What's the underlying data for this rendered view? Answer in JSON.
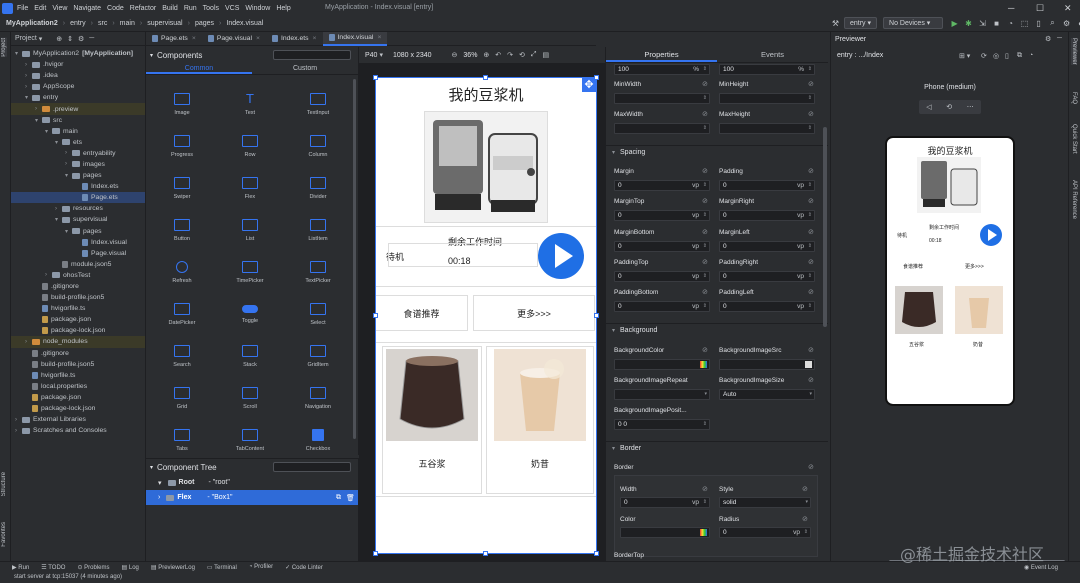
{
  "menu": [
    "File",
    "Edit",
    "View",
    "Navigate",
    "Code",
    "Refactor",
    "Build",
    "Run",
    "Tools",
    "VCS",
    "Window",
    "Help"
  ],
  "window_title": "MyApplication - Index.visual [entry]",
  "breadcrumbs": [
    "MyApplication2",
    "entry",
    "src",
    "main",
    "supervisual",
    "pages",
    "Index.visual"
  ],
  "run": {
    "config": "entry",
    "devices": "No Devices"
  },
  "project": {
    "title": "Project",
    "items": [
      {
        "label": "MyApplication2",
        "bold": "[MyApplication]",
        "indent": 0,
        "type": "folder"
      },
      {
        "label": ".hvigor",
        "indent": 1,
        "type": "folder"
      },
      {
        "label": ".idea",
        "indent": 1,
        "type": "folder"
      },
      {
        "label": "AppScope",
        "indent": 1,
        "type": "folder"
      },
      {
        "label": "entry",
        "indent": 1,
        "type": "folder"
      },
      {
        "label": ".preview",
        "indent": 2,
        "type": "folder-o"
      },
      {
        "label": "src",
        "indent": 2,
        "type": "folder"
      },
      {
        "label": "main",
        "indent": 3,
        "type": "folder"
      },
      {
        "label": "ets",
        "indent": 4,
        "type": "folder"
      },
      {
        "label": "entryability",
        "indent": 5,
        "type": "folder"
      },
      {
        "label": "images",
        "indent": 5,
        "type": "folder"
      },
      {
        "label": "pages",
        "indent": 5,
        "type": "folder"
      },
      {
        "label": "Index.ets",
        "indent": 6,
        "type": "file"
      },
      {
        "label": "Page.ets",
        "indent": 6,
        "type": "file"
      },
      {
        "label": "resources",
        "indent": 4,
        "type": "folder"
      },
      {
        "label": "supervisual",
        "indent": 4,
        "type": "folder"
      },
      {
        "label": "pages",
        "indent": 5,
        "type": "folder"
      },
      {
        "label": "Index.visual",
        "indent": 6,
        "type": "file"
      },
      {
        "label": "Page.visual",
        "indent": 6,
        "type": "file"
      },
      {
        "label": "module.json5",
        "indent": 4,
        "type": "file-g"
      },
      {
        "label": "ohosTest",
        "indent": 3,
        "type": "folder"
      },
      {
        "label": ".gitignore",
        "indent": 2,
        "type": "file-g"
      },
      {
        "label": "build-profile.json5",
        "indent": 2,
        "type": "file-g"
      },
      {
        "label": "hvigorfile.ts",
        "indent": 2,
        "type": "file"
      },
      {
        "label": "package.json",
        "indent": 2,
        "type": "file-j"
      },
      {
        "label": "package-lock.json",
        "indent": 2,
        "type": "file-j"
      },
      {
        "label": "node_modules",
        "indent": 1,
        "type": "folder-o"
      },
      {
        "label": ".gitignore",
        "indent": 1,
        "type": "file-g"
      },
      {
        "label": "build-profile.json5",
        "indent": 1,
        "type": "file-g"
      },
      {
        "label": "hvigorfile.ts",
        "indent": 1,
        "type": "file"
      },
      {
        "label": "local.properties",
        "indent": 1,
        "type": "file-g"
      },
      {
        "label": "package.json",
        "indent": 1,
        "type": "file-j"
      },
      {
        "label": "package-lock.json",
        "indent": 1,
        "type": "file-j"
      },
      {
        "label": "External Libraries",
        "indent": 0,
        "type": "folder"
      },
      {
        "label": "Scratches and Consoles",
        "indent": 0,
        "type": "folder"
      }
    ]
  },
  "tabs": [
    "Page.ets",
    "Page.visual",
    "Index.ets",
    "Index.visual"
  ],
  "components": {
    "title": "Components",
    "tabs": [
      "Common",
      "Custom"
    ],
    "items": [
      "Image",
      "Text",
      "TextInput",
      "Progress",
      "Row",
      "Column",
      "Swiper",
      "Flex",
      "Divider",
      "Button",
      "List",
      "ListItem",
      "Refresh",
      "TimePicker",
      "TextPicker",
      "DatePicker",
      "Toggle",
      "Select",
      "Search",
      "Stack",
      "GridItem",
      "Grid",
      "Scroll",
      "Navigation",
      "Tabs",
      "TabContent",
      "Checkbox"
    ]
  },
  "component_tree": {
    "title": "Component Tree",
    "rows": [
      {
        "name": "Root",
        "id": "- \"root\""
      },
      {
        "name": "Flex",
        "id": "- \"Box1\""
      }
    ]
  },
  "canvas": {
    "device": "P40",
    "resolution": "1080 x 2340",
    "zoom": "36%"
  },
  "phone": {
    "title": "我的豆浆机",
    "status": "待机",
    "remaining_label": "剩余工作时间",
    "time": "00:18",
    "btn_recipes": "食谱推荐",
    "btn_more": "更多>>>",
    "item1": "五谷浆",
    "item2": "奶昔"
  },
  "properties": {
    "tabs": [
      "Properties",
      "Events"
    ],
    "top_values": [
      "100",
      "100"
    ],
    "top_unit": "%",
    "minwidth": "MinWidth",
    "minheight": "MinHeight",
    "maxwidth": "MaxWidth",
    "maxheight": "MaxHeight",
    "spacing": "Spacing",
    "margin": "Margin",
    "padding": "Padding",
    "margintop": "MarginTop",
    "marginright": "MarginRight",
    "marginbottom": "MarginBottom",
    "marginleft": "MarginLeft",
    "paddingtop": "PaddingTop",
    "paddingright": "PaddingRight",
    "paddingbottom": "PaddingBottom",
    "paddingleft": "PaddingLeft",
    "zero": "0",
    "vp": "vp",
    "background": "Background",
    "bgcolor": "BackgroundColor",
    "bgimagesrc": "BackgroundImageSrc",
    "bgimagerepeat": "BackgroundImageRepeat",
    "bgimagesize": "BackgroundImageSize",
    "bgimagesize_val": "Auto",
    "bgimagepos": "BackgroundImagePosit...",
    "bgimagepos_val": "0 0",
    "border": "Border",
    "border_sub": "Border",
    "width": "Width",
    "style": "Style",
    "style_val": "solid",
    "color": "Color",
    "radius": "Radius",
    "bordertop": "BorderTop"
  },
  "previewer": {
    "title": "Previewer",
    "path": "entry : .../Index",
    "device": "Phone (medium)"
  },
  "preview_phone": {
    "title": "我的豆浆机",
    "status": "待机",
    "remaining": "剩余工作时间",
    "time": "00:18",
    "recipes": "食谱推荐",
    "more": "更多>>>",
    "item1": "五谷浆",
    "item2": "奶昔"
  },
  "left_strip": [
    "Project",
    "Structure",
    "Favorites"
  ],
  "right_strip": [
    "Previewer",
    "FAQ",
    "Quick Start",
    "API Reference"
  ],
  "statusbar": [
    "Run",
    "TODO",
    "Problems",
    "Log",
    "PreviewerLog",
    "Terminal",
    "Profiler",
    "Code Linter"
  ],
  "event_log": "Event Log",
  "bottom_text": "start server at tcp:15037 (4 minutes ago)",
  "watermark": "@稀土掘金技术社区",
  "colors": {
    "accent": "#3574f0",
    "bg": "#2b2d30",
    "dark": "#1e1f22"
  }
}
